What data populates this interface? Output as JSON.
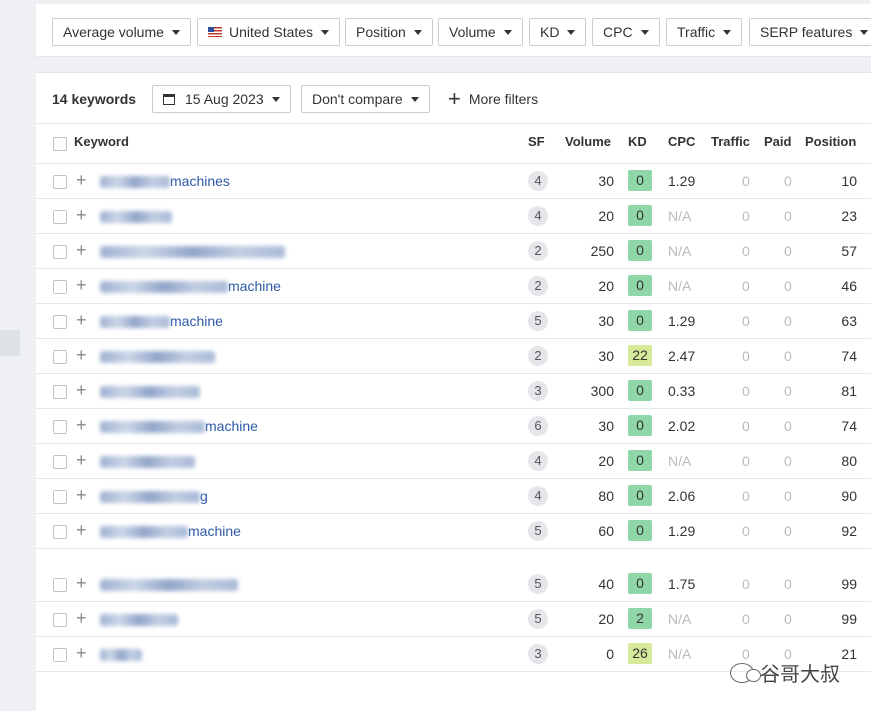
{
  "filters": [
    {
      "label": "Average volume",
      "flag": false
    },
    {
      "label": "United States",
      "flag": true
    },
    {
      "label": "Position",
      "flag": false
    },
    {
      "label": "Volume",
      "flag": false
    },
    {
      "label": "KD",
      "flag": false
    },
    {
      "label": "CPC",
      "flag": false
    },
    {
      "label": "Traffic",
      "flag": false
    },
    {
      "label": "SERP features",
      "flag": false
    }
  ],
  "subbar": {
    "keyword_count": "14 keywords",
    "date": "15 Aug 2023",
    "compare": "Don't compare",
    "more_filters": "More filters"
  },
  "columns": {
    "keyword": "Keyword",
    "sf": "SF",
    "volume": "Volume",
    "kd": "KD",
    "cpc": "CPC",
    "traffic": "Traffic",
    "paid": "Paid",
    "position": "Position"
  },
  "colors": {
    "kd_green": "#8fd6a8",
    "kd_yellow": "#d6ea9a",
    "link": "#2d5aa6"
  },
  "rows": [
    {
      "keyword": "machines",
      "sf": "4",
      "volume": "30",
      "kd": "0",
      "kd_color": "#8fd6a8",
      "cpc": "1.29",
      "traffic": "0",
      "paid": "0",
      "position": "10"
    },
    {
      "keyword": "",
      "sf": "4",
      "volume": "20",
      "kd": "0",
      "kd_color": "#8fd6a8",
      "cpc": "N/A",
      "traffic": "0",
      "paid": "0",
      "position": "23"
    },
    {
      "keyword": "",
      "sf": "2",
      "volume": "250",
      "kd": "0",
      "kd_color": "#8fd6a8",
      "cpc": "N/A",
      "traffic": "0",
      "paid": "0",
      "position": "57"
    },
    {
      "keyword": "machine",
      "sf": "2",
      "volume": "20",
      "kd": "0",
      "kd_color": "#8fd6a8",
      "cpc": "N/A",
      "traffic": "0",
      "paid": "0",
      "position": "46"
    },
    {
      "keyword": "machine",
      "sf": "5",
      "volume": "30",
      "kd": "0",
      "kd_color": "#8fd6a8",
      "cpc": "1.29",
      "traffic": "0",
      "paid": "0",
      "position": "63"
    },
    {
      "keyword": "",
      "sf": "2",
      "volume": "30",
      "kd": "22",
      "kd_color": "#d6ea9a",
      "cpc": "2.47",
      "traffic": "0",
      "paid": "0",
      "position": "74"
    },
    {
      "keyword": "",
      "sf": "3",
      "volume": "300",
      "kd": "0",
      "kd_color": "#8fd6a8",
      "cpc": "0.33",
      "traffic": "0",
      "paid": "0",
      "position": "81"
    },
    {
      "keyword": "machine",
      "sf": "6",
      "volume": "30",
      "kd": "0",
      "kd_color": "#8fd6a8",
      "cpc": "2.02",
      "traffic": "0",
      "paid": "0",
      "position": "74"
    },
    {
      "keyword": "",
      "sf": "4",
      "volume": "20",
      "kd": "0",
      "kd_color": "#8fd6a8",
      "cpc": "N/A",
      "traffic": "0",
      "paid": "0",
      "position": "80"
    },
    {
      "keyword": "g",
      "sf": "4",
      "volume": "80",
      "kd": "0",
      "kd_color": "#8fd6a8",
      "cpc": "2.06",
      "traffic": "0",
      "paid": "0",
      "position": "90"
    },
    {
      "keyword": "machine",
      "sf": "5",
      "volume": "60",
      "kd": "0",
      "kd_color": "#8fd6a8",
      "cpc": "1.29",
      "traffic": "0",
      "paid": "0",
      "position": "92"
    },
    {
      "keyword": "",
      "sf": "5",
      "volume": "40",
      "kd": "0",
      "kd_color": "#8fd6a8",
      "cpc": "1.75",
      "traffic": "0",
      "paid": "0",
      "position": "99"
    },
    {
      "keyword": "",
      "sf": "5",
      "volume": "20",
      "kd": "2",
      "kd_color": "#8fd6a8",
      "cpc": "N/A",
      "traffic": "0",
      "paid": "0",
      "position": "99"
    },
    {
      "keyword": "",
      "sf": "3",
      "volume": "0",
      "kd": "26",
      "kd_color": "#d6ea9a",
      "cpc": "N/A",
      "traffic": "0",
      "paid": "0",
      "position": "21"
    }
  ],
  "watermark": "谷哥大叔"
}
